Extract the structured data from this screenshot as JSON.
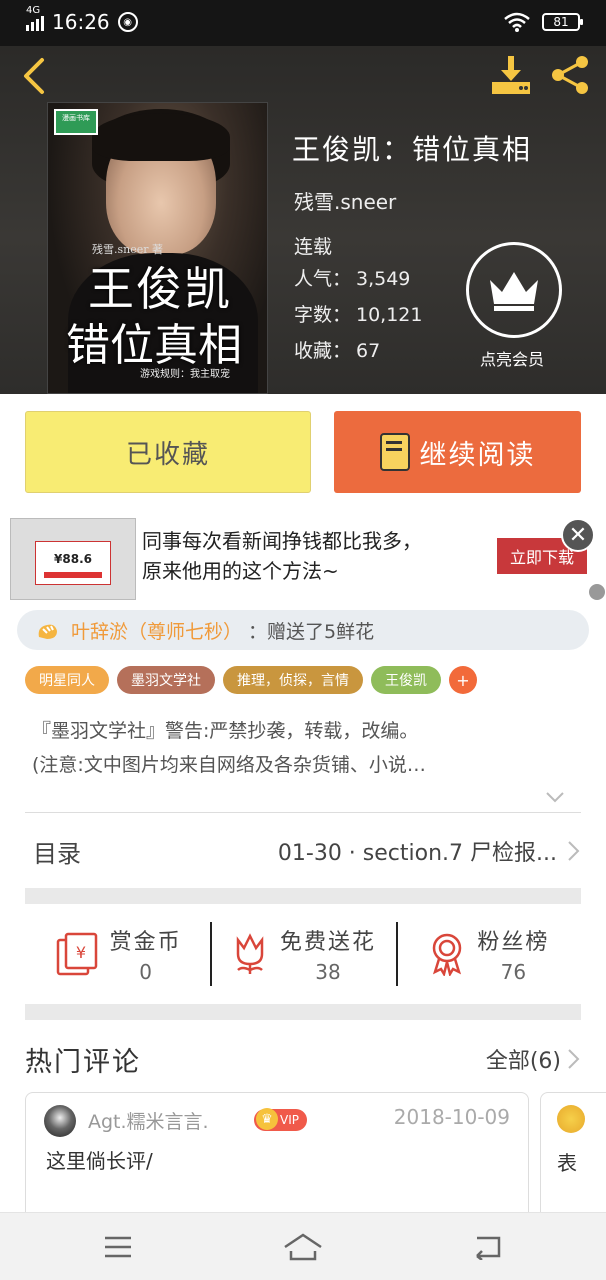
{
  "status_bar": {
    "network": "4G",
    "time": "16:26",
    "battery": "81"
  },
  "book": {
    "title": "王俊凯：错位真相",
    "author": "残雪.sneer",
    "status": "连载",
    "stats": [
      {
        "label": "人气",
        "value": "3,549"
      },
      {
        "label": "字数",
        "value": "10,121"
      },
      {
        "label": "收藏",
        "value": "67"
      }
    ],
    "cover": {
      "badge": "漫画书库",
      "author_line": "残雪.sneer 著",
      "title_line1": "王俊凯",
      "title_line2": "错位真相",
      "subtitle": "游戏规则：我主取宠"
    }
  },
  "member": {
    "label": "点亮会员"
  },
  "buttons": {
    "collected": "已收藏",
    "continue_read": "继续阅读"
  },
  "ad": {
    "thumb_price": "¥88.6",
    "line1": "同事每次看新闻挣钱都比我多，",
    "line2": "原来他用的这个方法~",
    "cta": "立即下载"
  },
  "gift": {
    "name": "叶辞淤（尊师七秒）",
    "message": "：赠送了5鲜花"
  },
  "tags": [
    {
      "label": "明星同人",
      "color": "#f2a94a"
    },
    {
      "label": "墨羽文学社",
      "color": "#b5705a"
    },
    {
      "label": "推理，侦探，言情",
      "color": "#c9963e"
    },
    {
      "label": "王俊凯",
      "color": "#8fbc5a"
    },
    {
      "label": "+",
      "color": "#f26a3a"
    }
  ],
  "description": {
    "line1": "『墨羽文学社』警告:严禁抄袭，转载，改编。",
    "line2": "(注意:文中图片均来自网络及各杂货铺、小说…"
  },
  "toc": {
    "label": "目录",
    "latest": "01-30 · section.7 尸检报..."
  },
  "rewards": [
    {
      "label": "赏金币",
      "count": "0",
      "color": "#d9463a"
    },
    {
      "label": "免费送花",
      "count": "38",
      "color": "#d9463a"
    },
    {
      "label": "粉丝榜",
      "count": "76",
      "color": "#d9463a"
    }
  ],
  "comments_section": {
    "title": "热门评论",
    "all_label": "全部(6)"
  },
  "comments": [
    {
      "user": "Agt.糯米言言.",
      "badge": "VIP",
      "date": "2018-10-09",
      "text": "这里倘长评/"
    },
    {
      "text": "表"
    }
  ],
  "colors": {
    "accent": "#ec6b3e",
    "collected_bg": "#f8ec73",
    "gift_name": "#f09a3a"
  }
}
